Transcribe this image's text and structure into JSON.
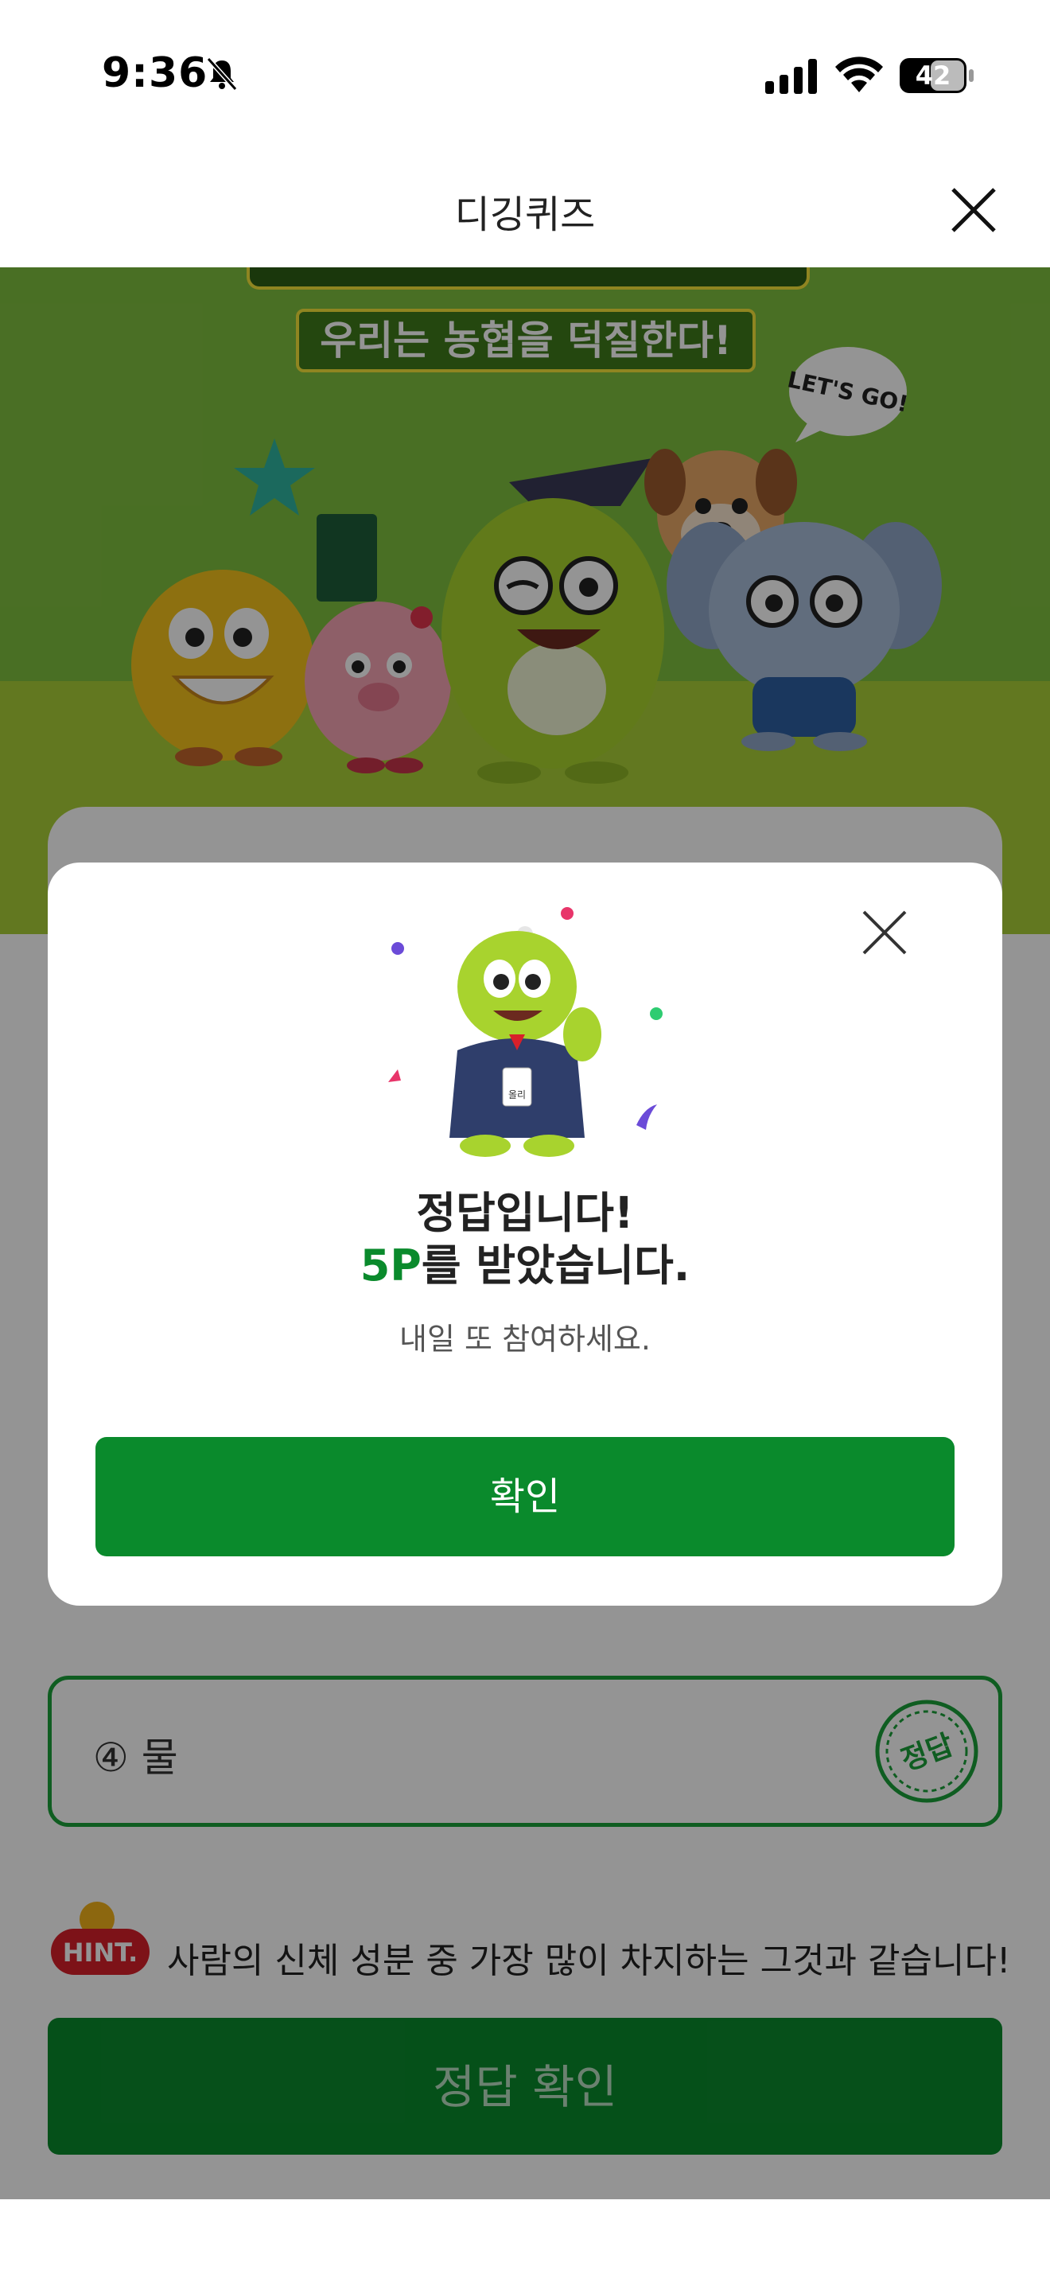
{
  "status_bar": {
    "time": "9:36",
    "battery_level": "42",
    "icons": [
      "bell-muted-icon",
      "signal-icon",
      "wifi-icon",
      "battery-icon"
    ]
  },
  "header": {
    "title": "디깅퀴즈",
    "close_icon": "close-icon"
  },
  "banner": {
    "title": "우리는 농협을 덕질한다!",
    "bubble_text": "LET'S GO!"
  },
  "quiz": {
    "option4_label": "④ 물",
    "stamp_text": "정답",
    "hint_badge": "HINT.",
    "hint_text": "사람의 신체 성분 중 가장 많이 차지하는 그것과 같습니다!",
    "submit_label": "정답 확인"
  },
  "modal": {
    "title_line1": "정답입니다!",
    "points": "5P",
    "title_line2_rest": "를 받았습니다.",
    "subtitle": "내일 또 참여하세요.",
    "confirm_label": "확인",
    "mascot_badge": "올리"
  },
  "colors": {
    "accent_green": "#0a8a2c",
    "banner_green": "#7fc03f",
    "banner_lime": "#a9cf37"
  }
}
